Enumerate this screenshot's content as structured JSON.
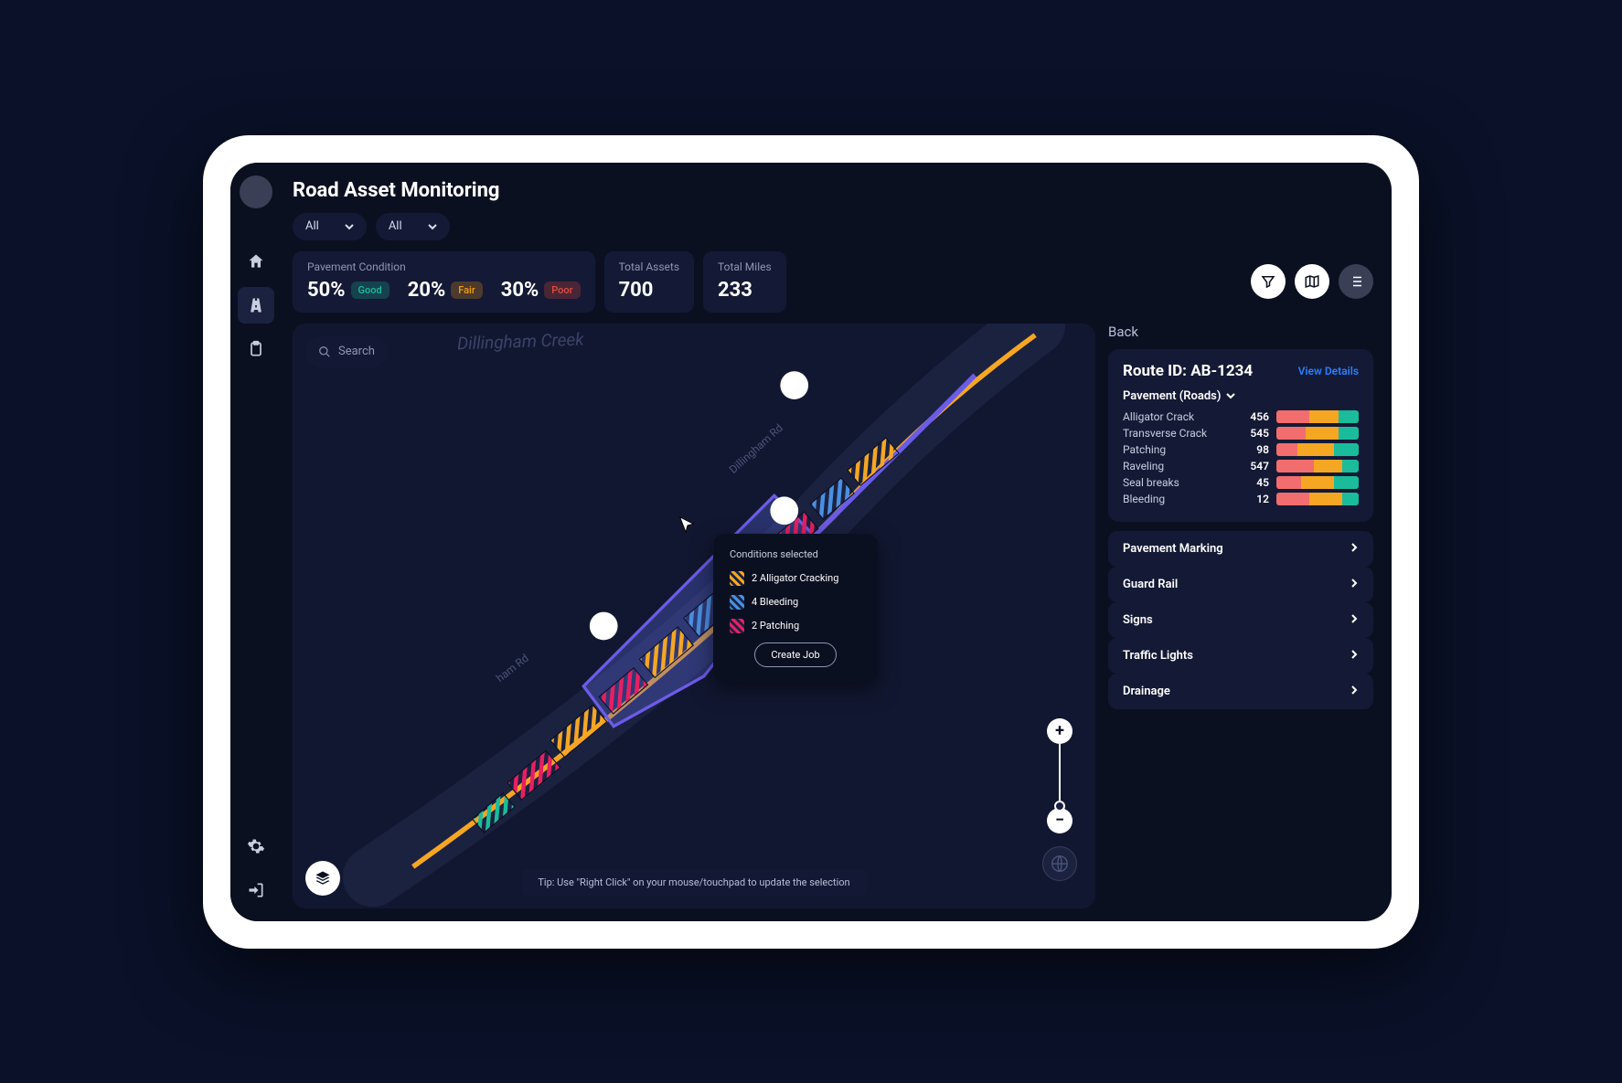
{
  "title": "Road Asset Monitoring",
  "filters": {
    "f1": "All",
    "f2": "All"
  },
  "stats": {
    "pc_label": "Pavement Condition",
    "good_pct": "50%",
    "good_badge": "Good",
    "fair_pct": "20%",
    "fair_badge": "Fair",
    "poor_pct": "30%",
    "poor_badge": "Poor",
    "assets_label": "Total Assets",
    "assets": "700",
    "miles_label": "Total Miles",
    "miles": "233"
  },
  "search_placeholder": "Search",
  "map": {
    "creek": "Dillingham Creek",
    "road": "Dillingham Rd",
    "road2": "ham Rd",
    "tip": "Tip: Use \"Right Click\" on your mouse/touchpad to update the selection"
  },
  "popup": {
    "title": "Conditions selected",
    "items": [
      {
        "label": "2 Alligator Cracking"
      },
      {
        "label": "4 Bleeding"
      },
      {
        "label": "2 Patching"
      }
    ],
    "action": "Create Job"
  },
  "right": {
    "back": "Back",
    "route_prefix": "Route ID: ",
    "route_id": "AB-1234",
    "view_details": "View Details",
    "section1": "Pavement (Roads)",
    "defects": [
      {
        "name": "Alligator Crack",
        "count": "456",
        "seg": [
          40,
          35,
          25
        ]
      },
      {
        "name": "Transverse Crack",
        "count": "545",
        "seg": [
          35,
          40,
          25
        ]
      },
      {
        "name": "Patching",
        "count": "98",
        "seg": [
          25,
          45,
          30
        ]
      },
      {
        "name": "Raveling",
        "count": "547",
        "seg": [
          45,
          35,
          20
        ]
      },
      {
        "name": "Seal breaks",
        "count": "45",
        "seg": [
          30,
          40,
          30
        ]
      },
      {
        "name": "Bleeding",
        "count": "12",
        "seg": [
          40,
          40,
          20
        ]
      }
    ],
    "sections": [
      "Pavement Marking",
      "Guard Rail",
      "Signs",
      "Traffic Lights",
      "Drainage"
    ]
  },
  "colors": {
    "poor": "#f26d6d",
    "fair": "#f5a623",
    "good": "#1abc9c"
  }
}
